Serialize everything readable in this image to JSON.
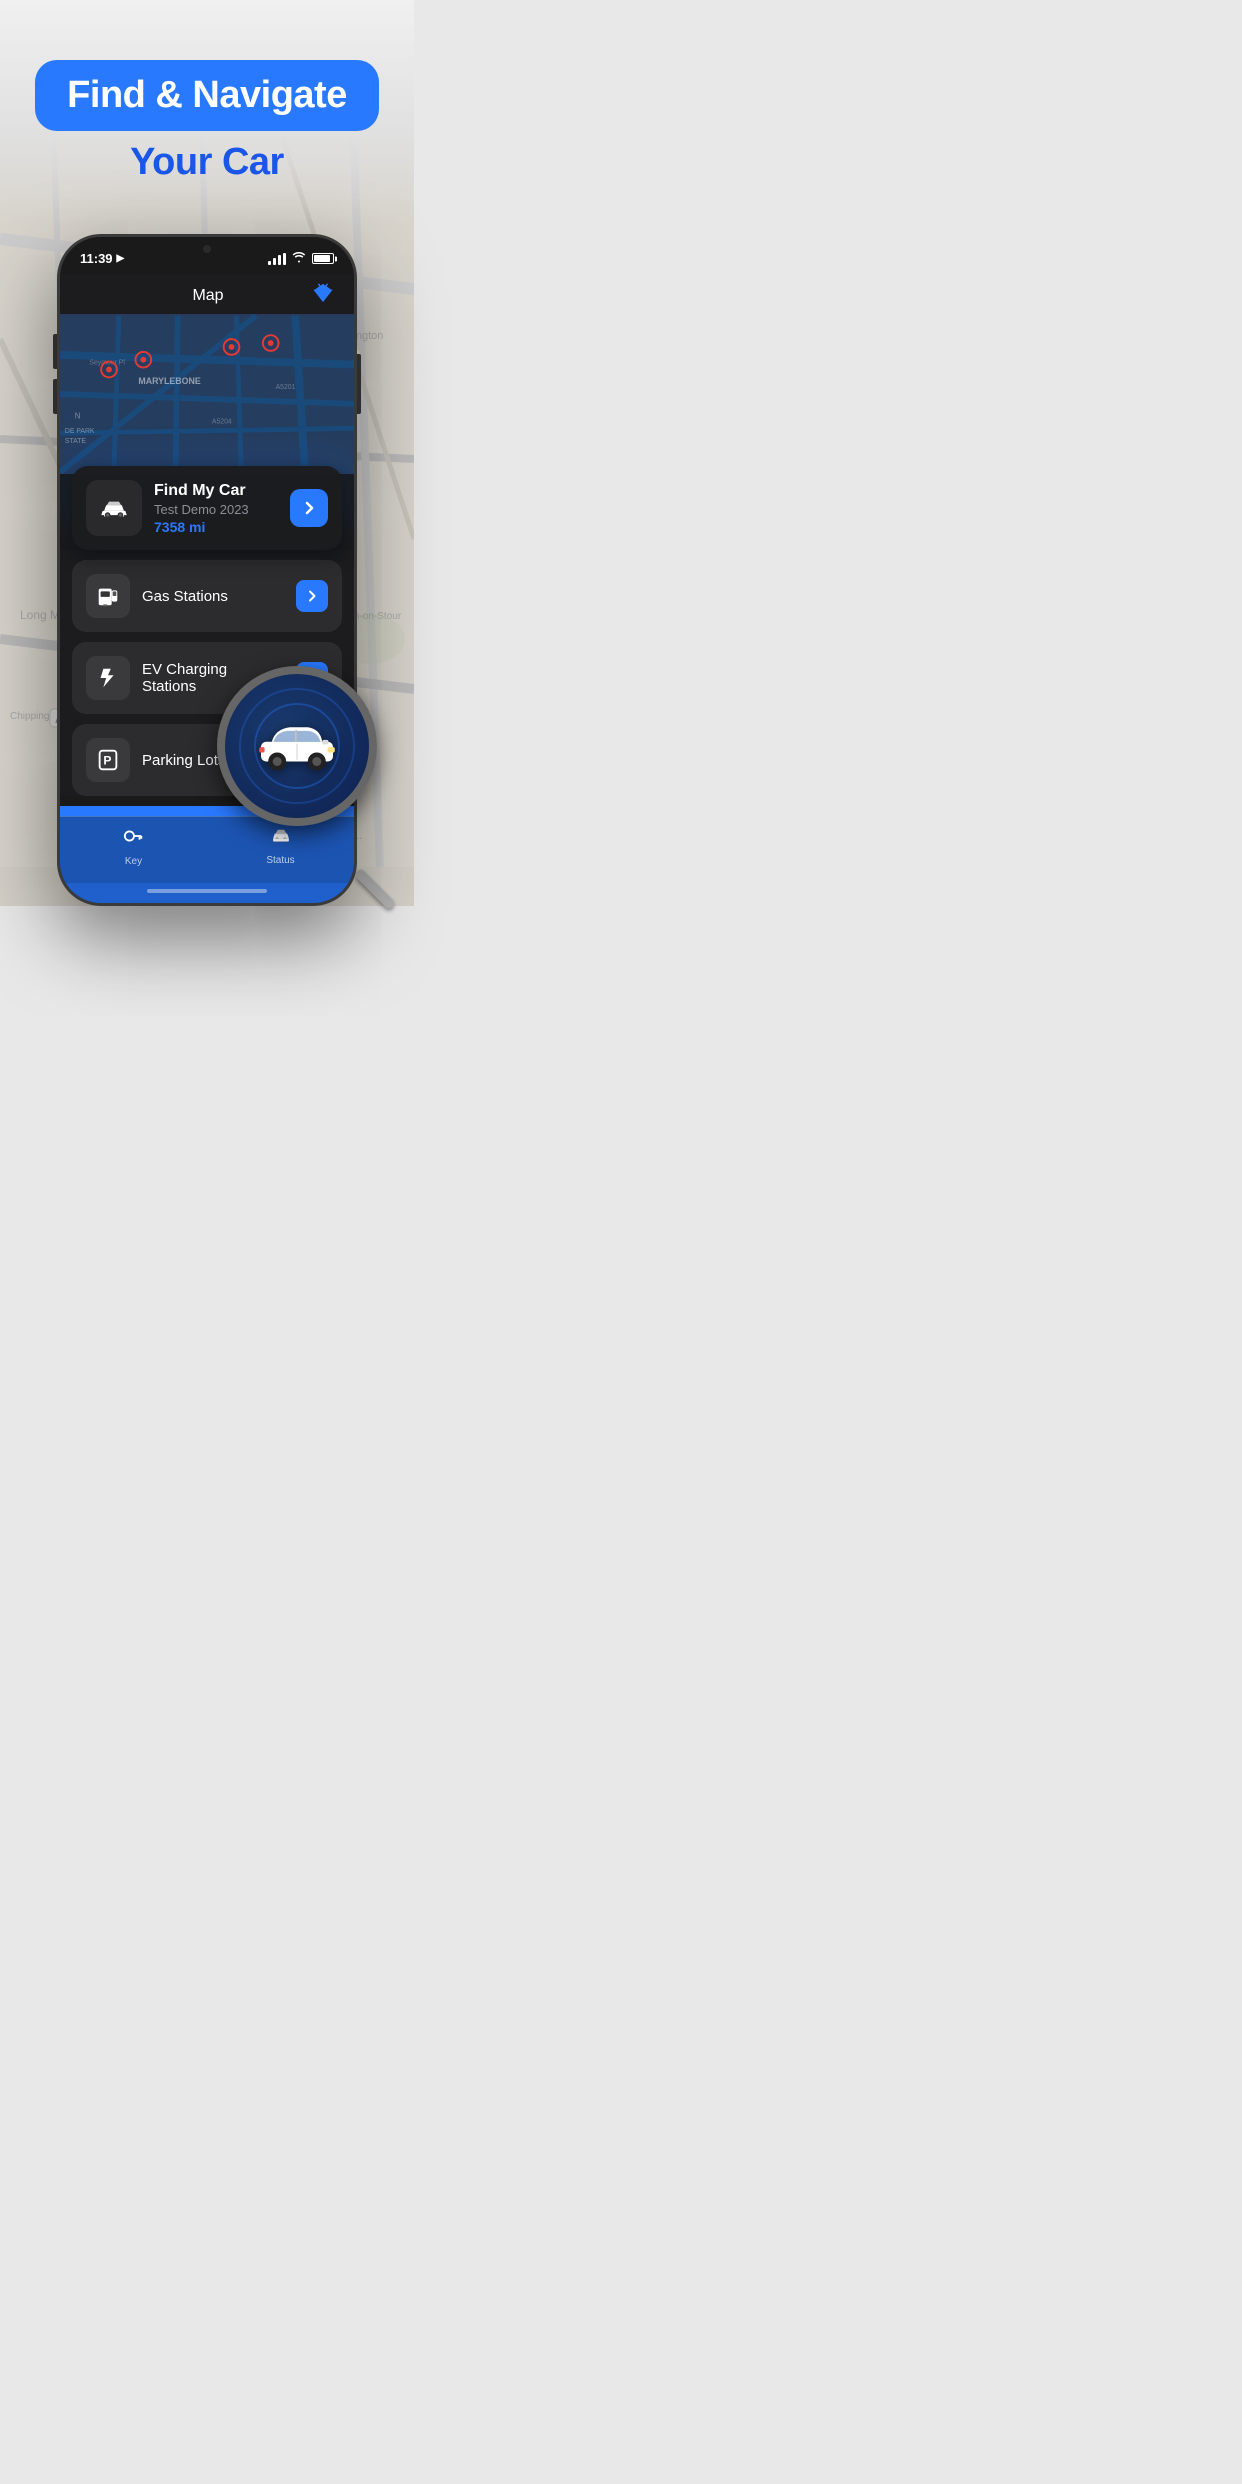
{
  "app": {
    "title": "Find & Navigate",
    "subtitle": "Your Car"
  },
  "status_bar": {
    "time": "11:39",
    "location_arrow": "▶"
  },
  "phone_nav": {
    "title": "Map"
  },
  "find_my_car": {
    "title": "Find My Car",
    "subtitle": "Test Demo 2023",
    "distance": "7358 mi"
  },
  "menu_items": [
    {
      "label": "Gas Stations",
      "icon": "gas-pump"
    },
    {
      "label": "EV Charging Stations",
      "icon": "ev-charger"
    },
    {
      "label": "Parking Lots",
      "icon": "parking"
    }
  ],
  "tab_bar": [
    {
      "label": "Key",
      "icon": "🔑"
    },
    {
      "label": "Status",
      "icon": "🚗"
    }
  ],
  "colors": {
    "blue": "#2979FF",
    "dark_bg": "#1c1c1e",
    "card_bg": "#2c2c2e"
  }
}
